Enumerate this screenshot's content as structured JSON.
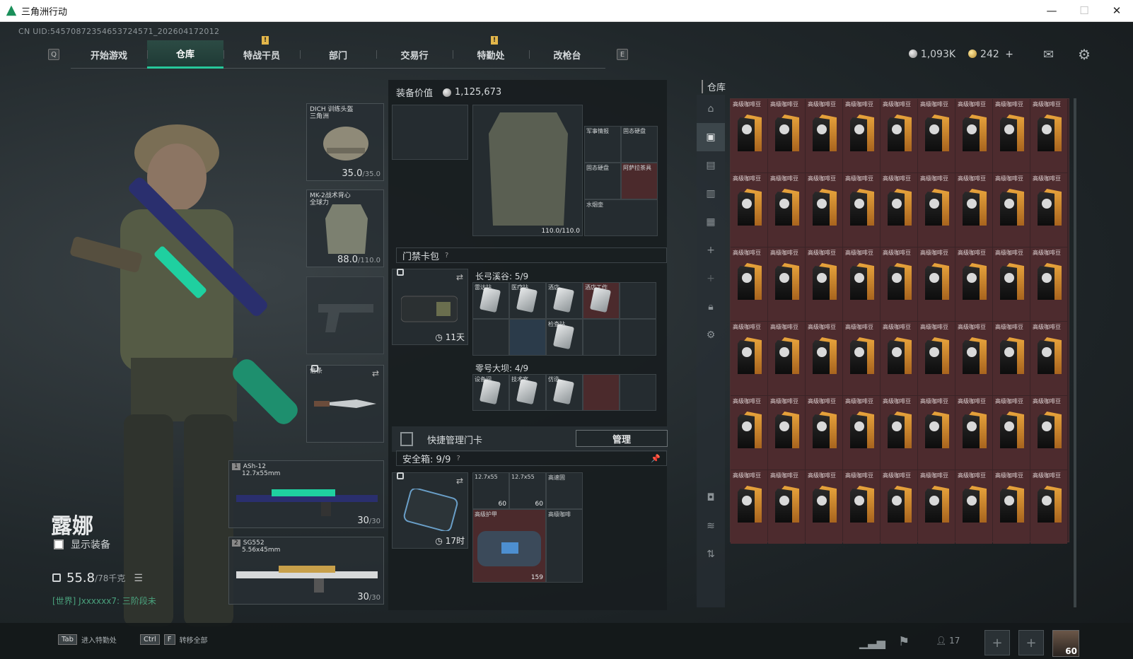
{
  "window": {
    "title": "三角洲行动"
  },
  "uid": "CN UID:5457087235465372457­1_202604172012",
  "nav": {
    "left_key": "Q",
    "right_key": "E",
    "tabs": [
      {
        "label": "开始游戏"
      },
      {
        "label": "仓库",
        "active": true
      },
      {
        "label": "特战干员",
        "alert": "!"
      },
      {
        "label": "部门"
      },
      {
        "label": "交易行"
      },
      {
        "label": "特勤处",
        "alert": "!"
      },
      {
        "label": "改枪台"
      }
    ]
  },
  "currency": {
    "silver": "1,093K",
    "gold": "242",
    "gold_add": "+"
  },
  "operator": {
    "name": "露娜",
    "show_equipment": "显示装备",
    "weight": "55.8",
    "weight_max": "/78千克",
    "chat": "[世界] Jxxxxxx7: 三阶段未"
  },
  "slots": {
    "helmet": {
      "label": "DICH 训练头盔",
      "sub": "三角洲",
      "durability": "35.0",
      "max": "/35.0"
    },
    "armor": {
      "label": "MK-2战术背心",
      "sub": "全球力",
      "durability": "88.0",
      "max": "/110.0"
    },
    "melee": {
      "label": "信条"
    },
    "primary1": {
      "index": "1",
      "name": "ASh-12",
      "caliber": "12.7x55mm",
      "ammo": "30",
      "max": "/30"
    },
    "primary2": {
      "index": "2",
      "name": "SG552",
      "caliber": "5.56x45mm",
      "ammo": "30",
      "max": "/30"
    }
  },
  "equipment_value": {
    "label": "装备价值",
    "value": "1,125,673"
  },
  "chest_rig": {
    "durability": "110.0/110.0",
    "items": [
      "军事情报",
      "固态硬盘",
      "固态硬盘",
      "阿萨拉茶具",
      "水烟壶"
    ]
  },
  "keycard": {
    "title": "门禁卡包",
    "help": "?",
    "timer": "11天",
    "groups": [
      {
        "name": "长弓溪谷: 5/9",
        "cards": [
          "雷达站",
          "医疗站",
          "酒店",
          "酒店工作",
          "检查站"
        ]
      },
      {
        "name": "零号大坝: 4/9",
        "cards": [
          "设备间",
          "技术室",
          "仿造"
        ]
      }
    ],
    "quick_manage": "快捷管理门卡",
    "manage_btn": "管理"
  },
  "safebox": {
    "title": "安全箱: 9/9",
    "help": "?",
    "timer": "17时",
    "items": [
      {
        "label": "12.7x55",
        "count": "60"
      },
      {
        "label": "12.7x55",
        "count": "60"
      },
      {
        "label": "高速固",
        "count": ""
      },
      {
        "label": "高级护甲",
        "count": "159"
      },
      {
        "label": "高级咖啡",
        "count": ""
      }
    ]
  },
  "warehouse": {
    "title": "仓库",
    "item_label": "高级咖啡豆",
    "rows": 6,
    "cols": 9
  },
  "bottom": {
    "tab_key": "Tab",
    "tab_label": "进入特勤处",
    "ctrl_key": "Ctrl",
    "f_key": "F",
    "transfer_label": "转移全部",
    "friends": "17",
    "level": "60"
  }
}
